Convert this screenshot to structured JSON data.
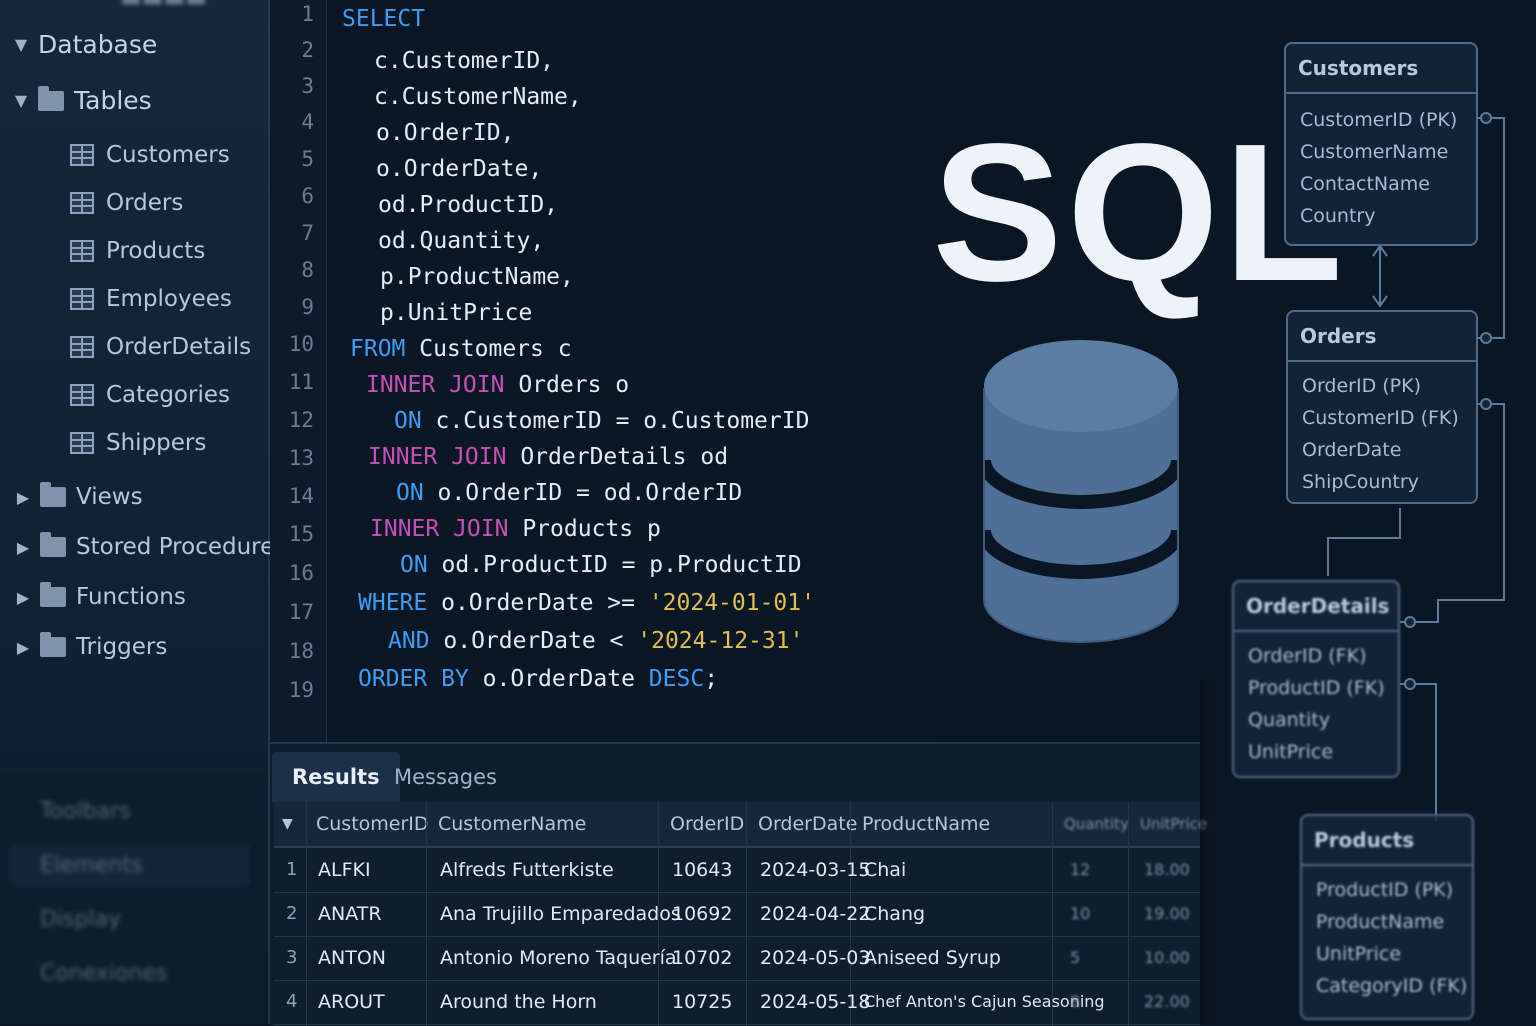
{
  "sidebar": {
    "database_label": "Database",
    "tables_label": "Tables",
    "tables": [
      "Customers",
      "Orders",
      "Products",
      "Employees",
      "OrderDetails",
      "Categories",
      "Shippers"
    ],
    "folders": [
      "Views",
      "Stored Procedures",
      "Functions",
      "Triggers"
    ],
    "bottom_items": [
      "Toolbars",
      "Elements",
      "Display",
      "Conexiones"
    ]
  },
  "editor": {
    "line_numbers": [
      "1",
      "2",
      "3",
      "4",
      "5",
      "6",
      "7",
      "8",
      "9",
      "10",
      "11",
      "12",
      "13",
      "14",
      "15",
      "16",
      "17",
      "18",
      "19"
    ],
    "code": {
      "l1_kw": "SELECT",
      "l2": "c.CustomerID,",
      "l3": "c.CustomerName,",
      "l4": "o.OrderID,",
      "l5": "o.OrderDate,",
      "l6": "od.ProductID,",
      "l7": "od.Quantity,",
      "l8": "p.ProductName,",
      "l9": "p.UnitPrice",
      "l10_kw": "FROM",
      "l10_rest": " Customers c",
      "l11_kw": "INNER JOIN",
      "l11_rest": " Orders o",
      "l12_kw": "ON",
      "l12_rest": " c.CustomerID = o.CustomerID",
      "l13_kw": "INNER JOIN",
      "l13_rest": " OrderDetails od",
      "l14_kw": "ON",
      "l14_rest": " o.OrderID = od.OrderID",
      "l15_kw": "INNER JOIN",
      "l15_rest": " Products p",
      "l16_kw": "ON",
      "l16_rest": " od.ProductID = p.ProductID",
      "l17_kw": "WHERE",
      "l17_rest": " o.OrderDate >= ",
      "l17_str": "'2024-01-01'",
      "l18_kw": "AND",
      "l18_rest": " o.OrderDate < ",
      "l18_str": "'2024-12-31'",
      "l19_kw": "ORDER BY",
      "l19_rest": " o.OrderDate ",
      "l19_kw2": "DESC",
      "l19_end": ";"
    }
  },
  "logo": {
    "title": "SQL"
  },
  "er_diagram": {
    "customers": {
      "title": "Customers",
      "fields": [
        "CustomerID (PK)",
        "CustomerName",
        "ContactName",
        "Country"
      ]
    },
    "orders": {
      "title": "Orders",
      "fields": [
        "OrderID (PK)",
        "CustomerID (FK)",
        "OrderDate",
        "ShipCountry"
      ]
    },
    "order_details": {
      "title": "OrderDetails",
      "fields": [
        "OrderID (FK)",
        "ProductID (FK)",
        "Quantity",
        "UnitPrice"
      ]
    },
    "products": {
      "title": "Products",
      "fields": [
        "ProductID (PK)",
        "ProductName",
        "UnitPrice",
        "CategoryID (FK)"
      ]
    }
  },
  "results": {
    "tabs": {
      "results": "Results",
      "messages": "Messages"
    },
    "headers": {
      "customer_id": "CustomerID",
      "customer_name": "CustomerName",
      "order_id": "OrderID",
      "order_date": "OrderDate",
      "product_name": "ProductName",
      "quantity": "Quantity",
      "unit_price": "UnitPrice"
    },
    "rows": [
      {
        "idx": "1",
        "customer_id": "ALFKI",
        "customer_name": "Alfreds Futterkiste",
        "order_id": "10643",
        "order_date": "2024-03-15",
        "product_name": "Chai",
        "quantity": "12",
        "unit_price": "18.00"
      },
      {
        "idx": "2",
        "customer_id": "ANATR",
        "customer_name": "Ana Trujillo Emparedados",
        "order_id": "10692",
        "order_date": "2024-04-22",
        "product_name": "Chang",
        "quantity": "10",
        "unit_price": "19.00"
      },
      {
        "idx": "3",
        "customer_id": "ANTON",
        "customer_name": "Antonio Moreno Taquería",
        "order_id": "10702",
        "order_date": "2024-05-03",
        "product_name": "Aniseed Syrup",
        "quantity": "5",
        "unit_price": "10.00"
      },
      {
        "idx": "4",
        "customer_id": "AROUT",
        "customer_name": "Around the Horn",
        "order_id": "10725",
        "order_date": "2024-05-18",
        "product_name": "Chef Anton's Cajun Seasoning",
        "quantity": "8",
        "unit_price": "22.00"
      }
    ]
  },
  "colors": {
    "keyword": "#3d9df2",
    "join": "#c451b4",
    "string": "#e0c04a",
    "db_icon": "#4f6f96"
  }
}
